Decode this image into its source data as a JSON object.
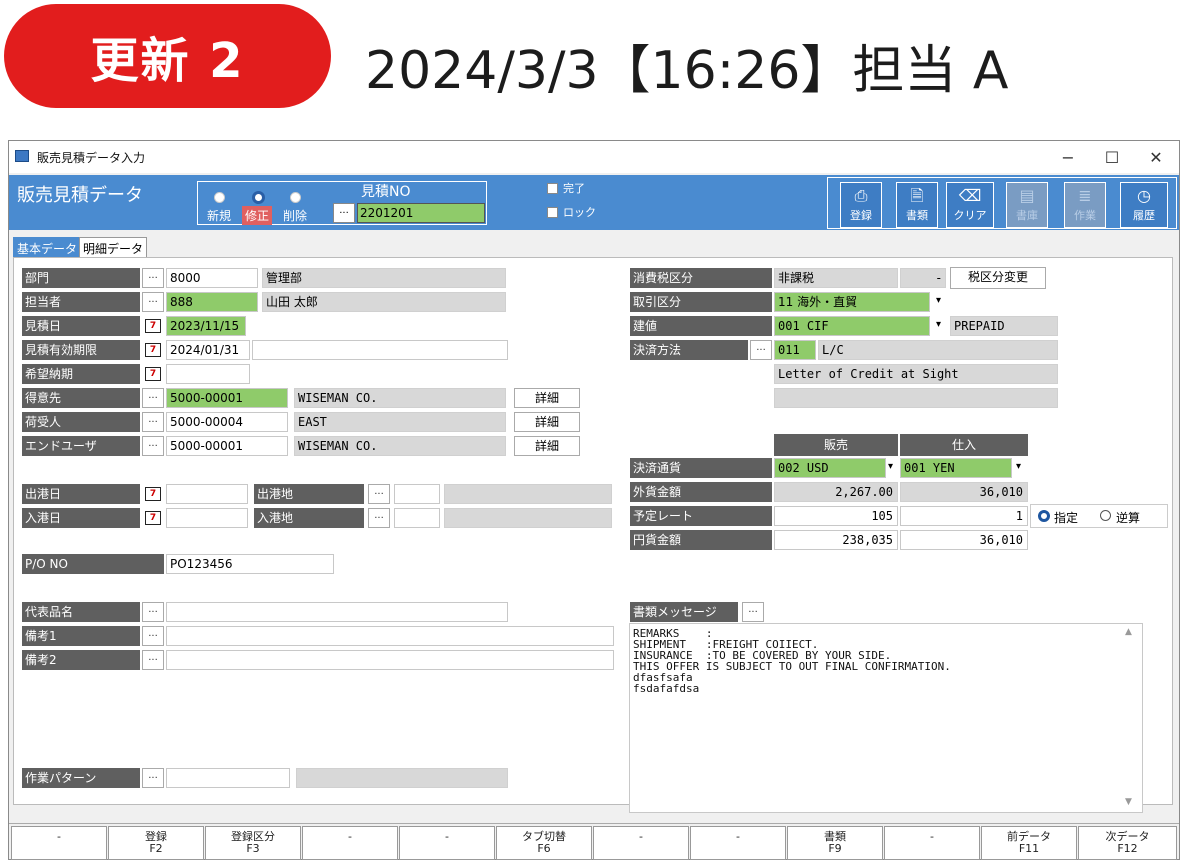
{
  "banner": {
    "badge": "更新 2",
    "title": "2024/3/3【16:26】担当 A"
  },
  "window": {
    "title": "販売見積データ入力",
    "controls": [
      "−",
      "☐",
      "✕"
    ]
  },
  "header": {
    "title": "販売見積データ",
    "modes": [
      {
        "label": "新規",
        "selected": false
      },
      {
        "label": "修正",
        "selected": true
      },
      {
        "label": "削除",
        "selected": false
      }
    ],
    "estimate_no_label": "見積NO",
    "estimate_no_button": "...",
    "estimate_no": "2201201",
    "checks": [
      {
        "label": "完了",
        "checked": false
      },
      {
        "label": "ロック",
        "checked": false
      }
    ],
    "toolbar": [
      {
        "label": "登録",
        "icon": "⎙",
        "enabled": true
      },
      {
        "label": "書類",
        "icon": "🗎",
        "enabled": true
      },
      {
        "label": "クリア",
        "icon": "⌫",
        "enabled": true
      },
      {
        "label": "書庫",
        "icon": "▤",
        "enabled": false
      },
      {
        "label": "作業",
        "icon": "≣",
        "enabled": false
      },
      {
        "label": "履歴",
        "icon": "◷",
        "enabled": true
      }
    ]
  },
  "tabs": [
    "基本データ",
    "明細データ"
  ],
  "left": {
    "dept": {
      "label": "部門",
      "code": "8000",
      "name": "管理部"
    },
    "staff": {
      "label": "担当者",
      "code": "888",
      "name": "山田 太郎"
    },
    "est_date": {
      "label": "見積日",
      "value": "2023/11/15"
    },
    "valid_until": {
      "label": "見積有効期限",
      "value": "2024/01/31",
      "extra": ""
    },
    "desired_date": {
      "label": "希望納期",
      "value": ""
    },
    "customer": {
      "label": "得意先",
      "code": "5000-00001",
      "name": "WISEMAN CO.",
      "button": "詳細"
    },
    "consignee": {
      "label": "荷受人",
      "code": "5000-00004",
      "name": "EAST",
      "button": "詳細"
    },
    "enduser": {
      "label": "エンドユーザ",
      "code": "5000-00001",
      "name": "WISEMAN CO.",
      "button": "詳細"
    },
    "ship_date": {
      "label": "出港日",
      "value": "",
      "port_label": "出港地",
      "port_code": "",
      "port_name": ""
    },
    "arrive_date": {
      "label": "入港日",
      "value": "",
      "port_label": "入港地",
      "port_code": "",
      "port_name": ""
    },
    "po": {
      "label": "P/O NO",
      "value": "PO123456"
    },
    "rep_item": {
      "label": "代表品名",
      "value": ""
    },
    "note1": {
      "label": "備考1",
      "value": ""
    },
    "note2": {
      "label": "備考2",
      "value": ""
    },
    "work_pattern": {
      "label": "作業パターン",
      "code": "",
      "name": ""
    }
  },
  "right": {
    "tax": {
      "label": "消費税区分",
      "value": "非課税",
      "dash": "-",
      "button": "税区分変更"
    },
    "trade": {
      "label": "取引区分",
      "value": "11 海外・直貿"
    },
    "price_basis": {
      "label": "建値",
      "value": "001 CIF",
      "extra": "PREPAID"
    },
    "payment": {
      "label": "決済方法",
      "code": "011",
      "name": "L/C",
      "desc": "Letter of Credit at Sight",
      "desc2": ""
    },
    "col_sales": "販売",
    "col_purchase": "仕入",
    "currency": {
      "label": "決済通貨",
      "sales": "002 USD",
      "purchase": "001 YEN"
    },
    "foreign_amount": {
      "label": "外貨金額",
      "sales": "2,267.00",
      "purchase": "36,010"
    },
    "rate": {
      "label": "予定レート",
      "sales": "105",
      "purchase": "1",
      "opt_specified": "指定",
      "opt_reverse": "逆算"
    },
    "yen_amount": {
      "label": "円貨金額",
      "sales": "238,035",
      "purchase": "36,010"
    },
    "doc_message": {
      "label": "書類メッセージ",
      "text": "REMARKS    :\nSHIPMENT   :FREIGHT COIIECT.\nINSURANCE  :TO BE COVERED BY YOUR SIDE.\nTHIS OFFER IS SUBJECT TO OUT FINAL CONFIRMATION.\ndfasfsafa\nfsdafafdsa"
    }
  },
  "fkeys": [
    {
      "l1": "-",
      "l2": ""
    },
    {
      "l1": "登録",
      "l2": "F2"
    },
    {
      "l1": "登録区分",
      "l2": "F3"
    },
    {
      "l1": "-",
      "l2": ""
    },
    {
      "l1": "-",
      "l2": ""
    },
    {
      "l1": "タブ切替",
      "l2": "F6"
    },
    {
      "l1": "-",
      "l2": ""
    },
    {
      "l1": "-",
      "l2": ""
    },
    {
      "l1": "書類",
      "l2": "F9"
    },
    {
      "l1": "-",
      "l2": ""
    },
    {
      "l1": "前データ",
      "l2": "F11"
    },
    {
      "l1": "次データ",
      "l2": "F12"
    }
  ],
  "colors": {
    "banner": "#e21d1d",
    "header": "#4a8bd0",
    "label_bg": "#5f5f5f",
    "required_green": "#8fcb6a"
  }
}
